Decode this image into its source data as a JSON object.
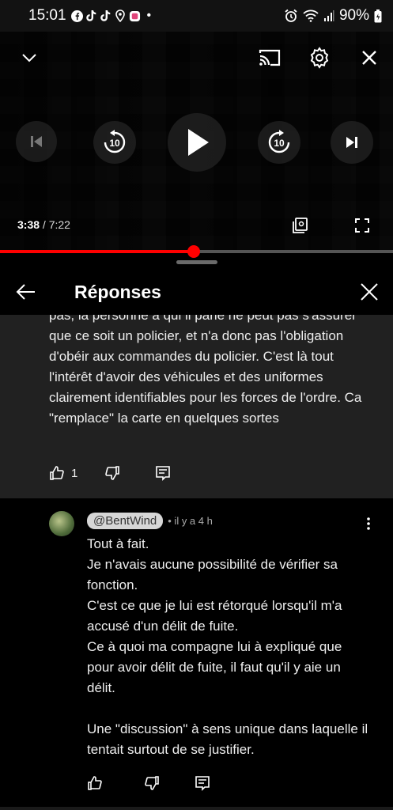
{
  "status_bar": {
    "time": "15:01",
    "app_icons": [
      "facebook-icon",
      "tiktok-icon",
      "tiktok-icon",
      "location-icon",
      "app-icon"
    ],
    "dot": "•",
    "battery": "90%"
  },
  "player": {
    "current_time": "3:38",
    "separator": " / ",
    "total_time": "7:22",
    "progress_fraction": 0.492,
    "progress_color": "#ff0000",
    "seek_back_seconds": "10",
    "seek_forward_seconds": "10"
  },
  "replies_panel": {
    "title": "Réponses"
  },
  "parent_comment": {
    "text": "pas, la personne à qui il parle ne peut pas s'assurer que ce soit un policier, et n'a donc pas l'obligation d'obéir aux commandes du policier. C'est là tout l'intérêt d'avoir des véhicules et des uniformes clairement identifiables pour les forces de l'ordre. Ca \"remplace\" la carte en quelques sortes",
    "like_count": "1"
  },
  "reply": {
    "author": "@BentWind",
    "meta": "• il y a 4 h",
    "text": "Tout à fait.\nJe n'avais aucune possibilité de vérifier sa fonction.\nC'est ce que je lui est rétorqué lorsqu'il m'a accusé d'un délit de fuite.\nCe à quoi ma compagne lui à expliqué que pour avoir délit de fuite, il faut qu'il y aie un délit.\n\nUne \"discussion\" à sens unique dans laquelle il tentait surtout de se justifier."
  }
}
